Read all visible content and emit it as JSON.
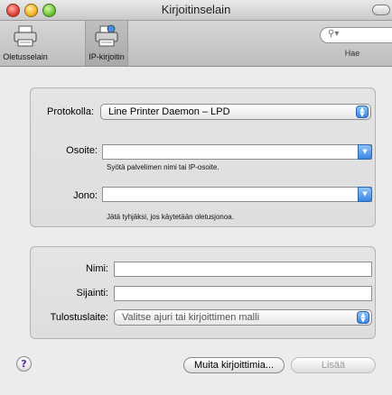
{
  "window": {
    "title": "Kirjoitinselain"
  },
  "toolbar": {
    "items": [
      {
        "label": "Oletusselain",
        "icon": "printer-icon",
        "selected": false
      },
      {
        "label": "IP-kirjoitin",
        "icon": "ip-printer-icon",
        "selected": true
      }
    ],
    "search": {
      "placeholder": "",
      "label": "Hae"
    }
  },
  "form": {
    "protocol": {
      "label": "Protokolla:",
      "value": "Line Printer Daemon – LPD"
    },
    "address": {
      "label": "Osoite:",
      "value": "",
      "hint": "Syötä palvelimen nimi tai IP-osoite."
    },
    "queue": {
      "label": "Jono:",
      "value": "",
      "hint": "Jätä tyhjäksi, jos käytetään oletusjonoa."
    },
    "name": {
      "label": "Nimi:",
      "value": ""
    },
    "location": {
      "label": "Sijainti:",
      "value": ""
    },
    "driver": {
      "label": "Tulostuslaite:",
      "value": "Valitse ajuri tai kirjoittimen malli"
    }
  },
  "buttons": {
    "help": "?",
    "more_printers": "Muita kirjoittimia...",
    "add": "Lisää"
  },
  "colors": {
    "accent": "#3a88e3"
  }
}
